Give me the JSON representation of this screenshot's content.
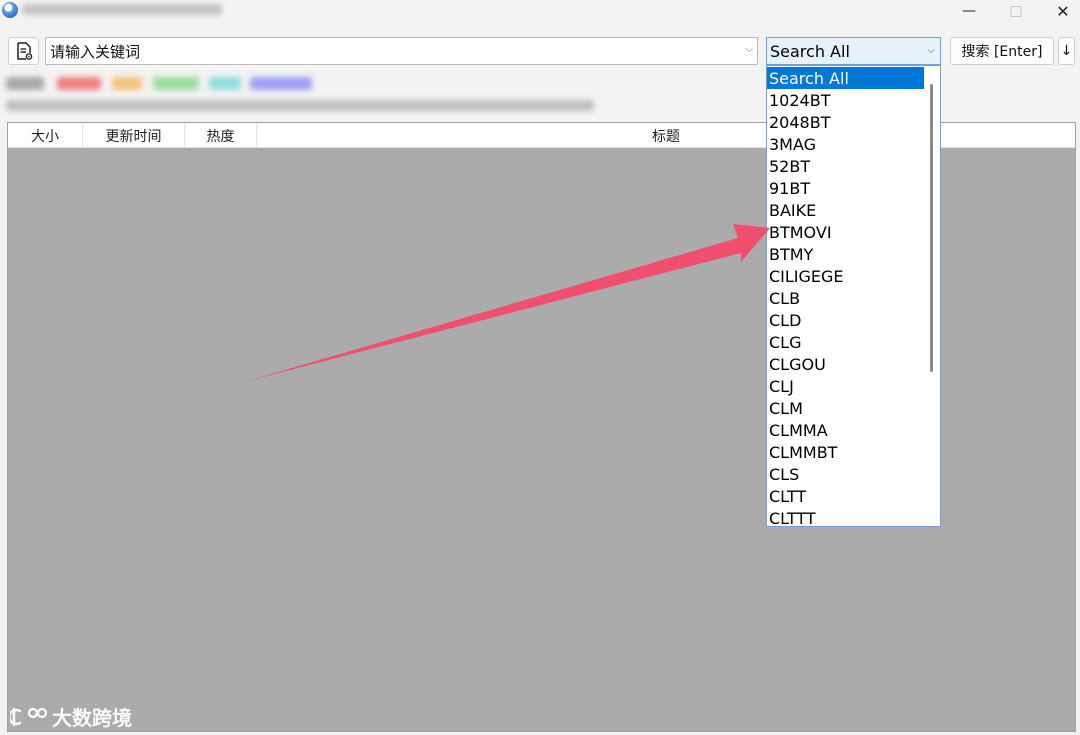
{
  "toolbar": {
    "keyword_placeholder": "请输入关键词",
    "site_selected": "Search All",
    "search_button": "搜索 [Enter]",
    "sort_button": "↓"
  },
  "table": {
    "columns": [
      "大小",
      "更新时间",
      "热度",
      "标题"
    ]
  },
  "dropdown": {
    "items": [
      "Search All",
      "1024BT",
      "2048BT",
      "3MAG",
      "52BT",
      "91BT",
      "BAIKE",
      "BTMOVI",
      "BTMY",
      "CILIGEGE",
      "CLB",
      "CLD",
      "CLG",
      "CLGOU",
      "CLJ",
      "CLM",
      "CLMMA",
      "CLMMBT",
      "CLS",
      "CLTT",
      "CLTTT"
    ],
    "selected_index": 0
  },
  "watermark": {
    "text": "大数跨境"
  },
  "colors": {
    "accent": "#0078d7",
    "annotation_arrow": "#f0506e",
    "table_background": "#ababab"
  }
}
